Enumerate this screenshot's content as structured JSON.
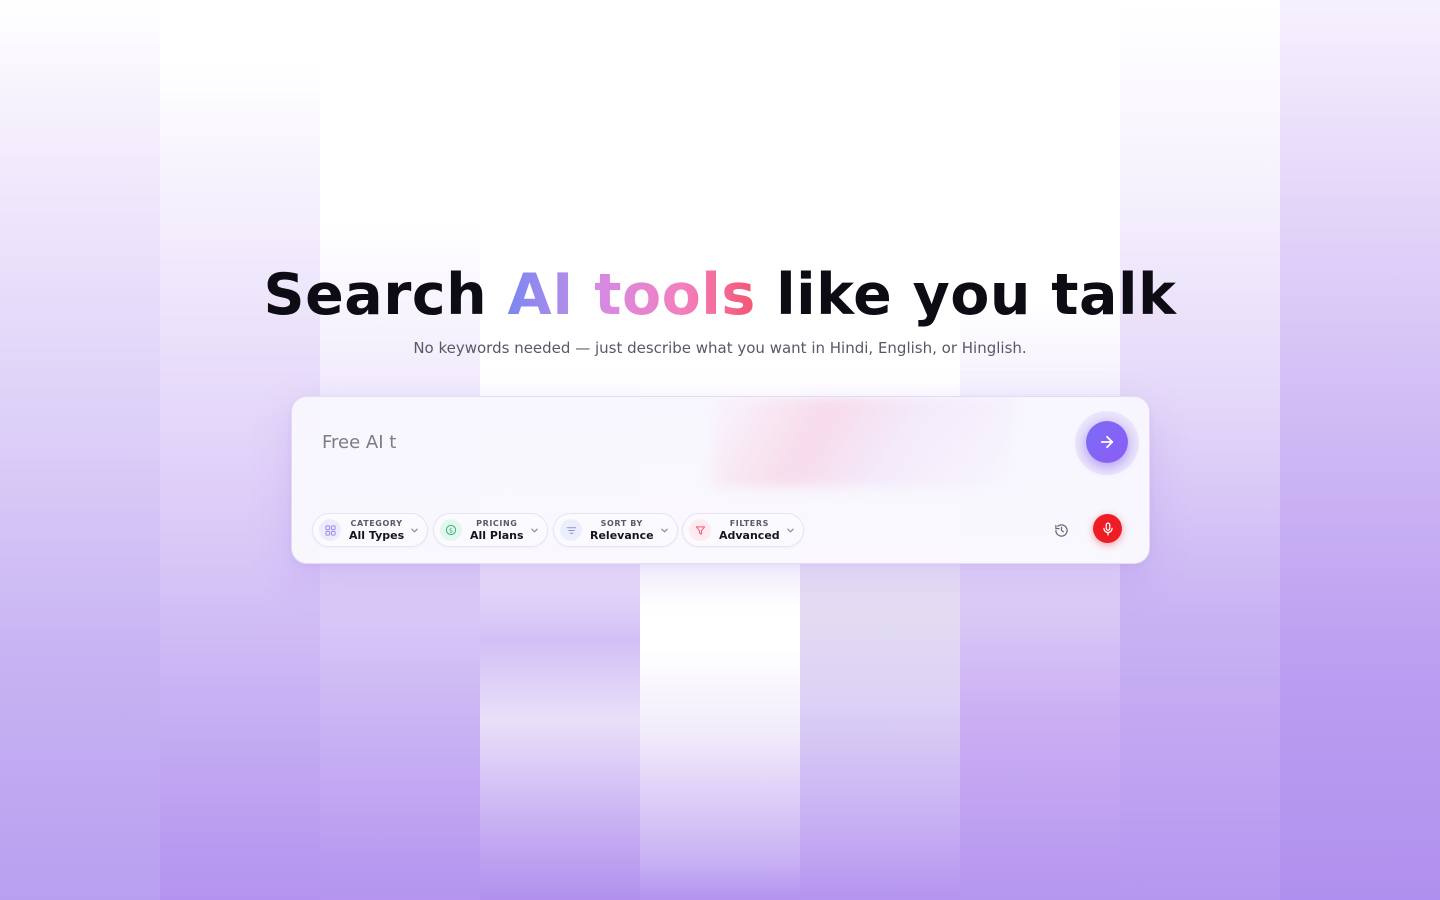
{
  "hero": {
    "title_part1": "Search ",
    "title_ai": "AI",
    "title_space": " ",
    "title_tools": "tools",
    "title_part2": " like you talk",
    "subtitle": "No keywords needed — just describe what you want in Hindi, English, or Hinglish."
  },
  "search": {
    "value": "Free AI t",
    "submit_icon": "arrow-right-icon",
    "history_icon": "history-icon",
    "mic_icon": "microphone-icon"
  },
  "chips": [
    {
      "label": "CATEGORY",
      "value": "All Types",
      "icon": "grid-icon"
    },
    {
      "label": "PRICING",
      "value": "All Plans",
      "icon": "dollar-icon"
    },
    {
      "label": "SORT BY",
      "value": "Relevance",
      "icon": "sort-lines-icon"
    },
    {
      "label": "FILTERS",
      "value": "Advanced",
      "icon": "funnel-icon"
    }
  ],
  "colors": {
    "accent": "#8b5cf6",
    "mic": "#ee1c24",
    "heading": "#0d0b14"
  }
}
